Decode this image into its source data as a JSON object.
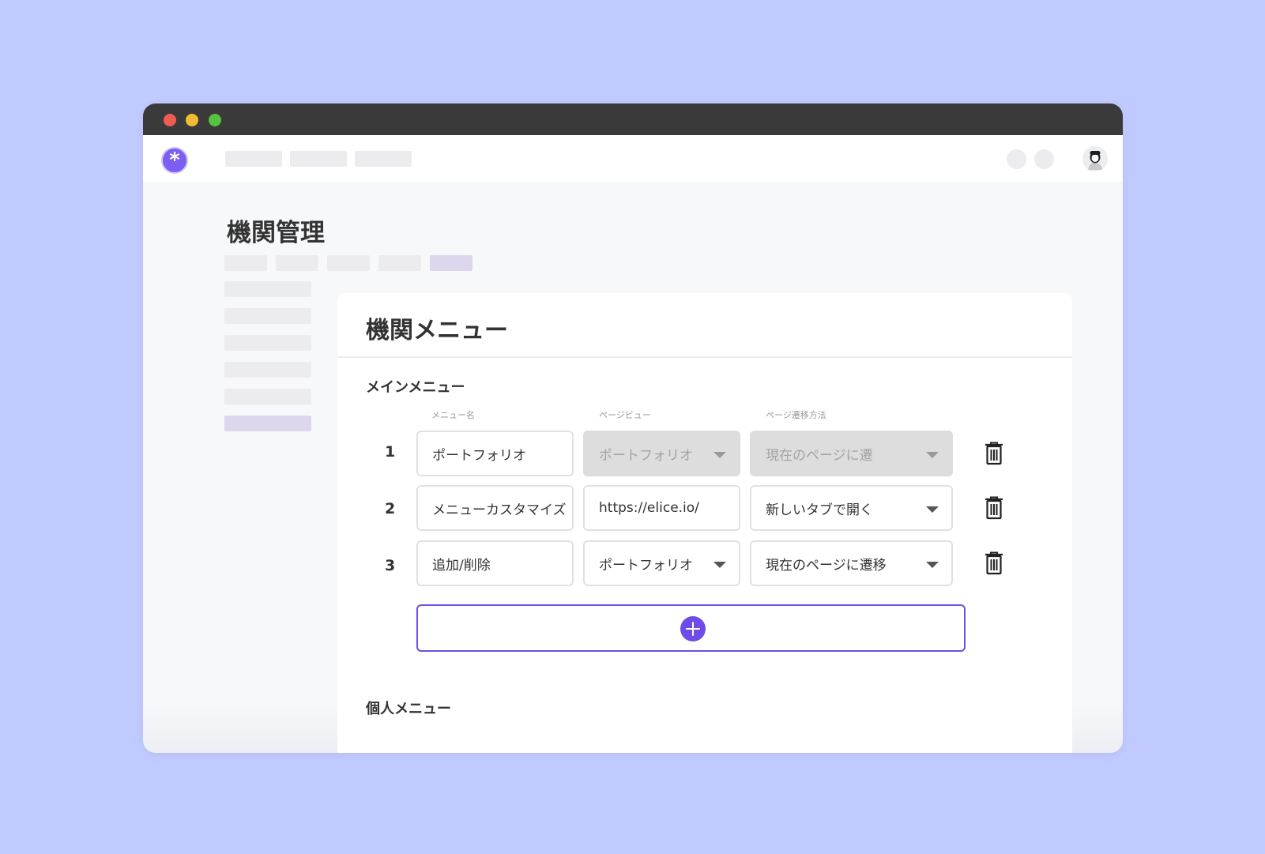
{
  "window": {
    "traffic_lights": [
      {
        "name": "close",
        "color": "#ef5c55"
      },
      {
        "name": "minimize",
        "color": "#f4bb32"
      },
      {
        "name": "zoom",
        "color": "#56c340"
      }
    ]
  },
  "topnav": {
    "logo_glyph": "*",
    "logo_icon": "asterisk-logo-icon",
    "accent_color": "#7c5ef0"
  },
  "page": {
    "title": "機関管理"
  },
  "card": {
    "title": "機関メニュー",
    "main_section_title": "メインメニュー",
    "personal_section_title": "個人メニュー",
    "columns": {
      "name": "メニュー名",
      "page_view": "ページビュー",
      "transition": "ページ遷移方法"
    },
    "rows": [
      {
        "num": "1",
        "name": "ポートフォリオ",
        "page_view": "ポートフォリオ",
        "transition": "現在のページに遷",
        "disabled": true
      },
      {
        "num": "2",
        "name": "メニューカスタマイズ",
        "page_view": "https://elice.io/",
        "transition": "新しいタブで開く",
        "disabled": false
      },
      {
        "num": "3",
        "name": "追加/削除",
        "page_view": "ポートフォリオ",
        "transition": "現在のページに遷移",
        "disabled": false
      }
    ],
    "add_button_icon": "plus-circle-icon",
    "add_button_color": "#6e4ee6"
  }
}
